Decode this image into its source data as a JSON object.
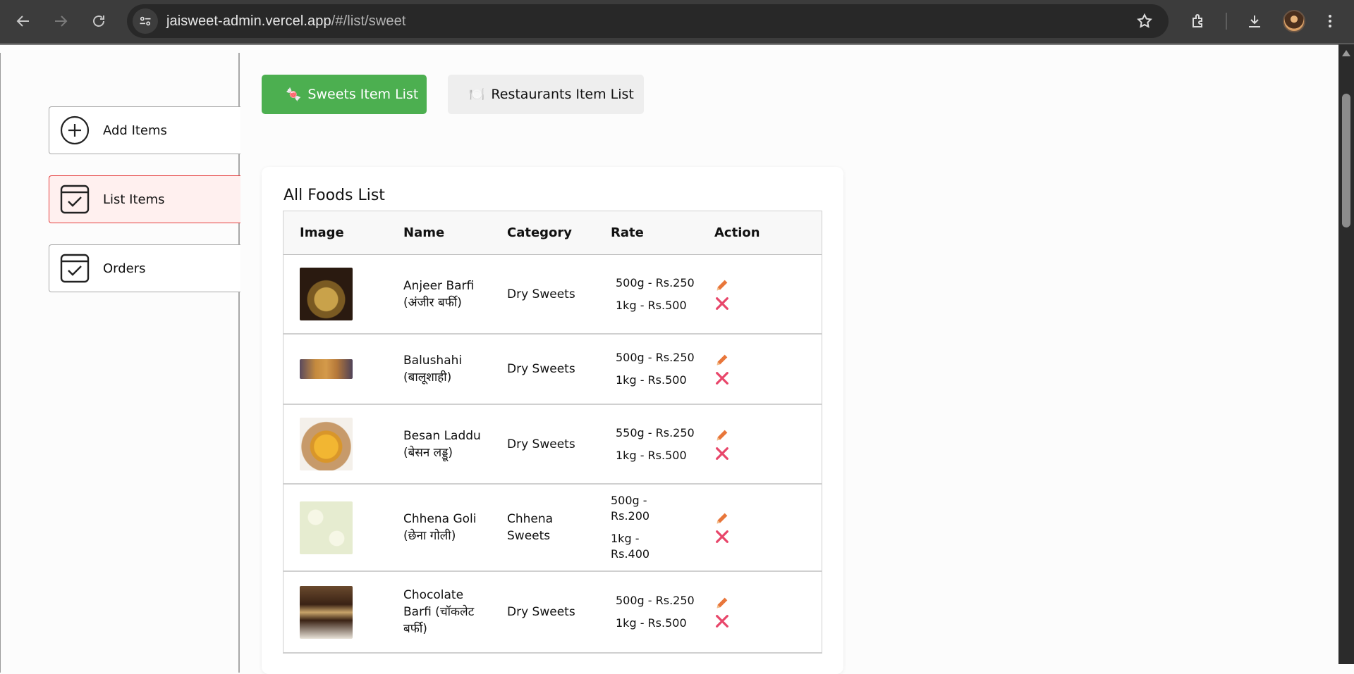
{
  "browser": {
    "url_host": "jaisweet-admin.vercel.app",
    "url_path": "/#/list/sweet"
  },
  "sidebar": {
    "items": [
      {
        "label": "Add Items",
        "icon": "plus-circle-icon"
      },
      {
        "label": "List Items",
        "icon": "list-check-icon",
        "active": true
      },
      {
        "label": "Orders",
        "icon": "list-check-icon"
      }
    ]
  },
  "tabs": {
    "sweets": {
      "emoji": "🍬",
      "label": "Sweets Item List"
    },
    "restaurants": {
      "emoji": "🍽️",
      "label": "Restaurants Item List"
    }
  },
  "list": {
    "title": "All Foods List",
    "headers": {
      "image": "Image",
      "name": "Name",
      "category": "Category",
      "rate": "Rate",
      "action": "Action"
    },
    "rows": [
      {
        "name": "Anjeer Barfi (अंजीर बर्फी)",
        "category": "Dry Sweets",
        "rate1": "500g - Rs.250",
        "rate2": "1kg - Rs.500"
      },
      {
        "name": "Balushahi (बालूशाही)",
        "category": "Dry Sweets",
        "rate1": "500g - Rs.250",
        "rate2": "1kg - Rs.500"
      },
      {
        "name": "Besan Laddu (बेसन लड्डू)",
        "category": "Dry Sweets",
        "rate1": "550g - Rs.250",
        "rate2": "1kg - Rs.500"
      },
      {
        "name": "Chhena Goli (छेना गोली)",
        "category": "Chhena Sweets",
        "rate1": "500g - Rs.200",
        "rate2": "1kg - Rs.400"
      },
      {
        "name": "Chocolate Barfi (चॉकलेट बर्फी)",
        "category": "Dry Sweets",
        "rate1": "500g - Rs.250",
        "rate2": "1kg - Rs.500"
      }
    ]
  },
  "colors": {
    "accent_green": "#4caf50",
    "active_border": "#e53e3e",
    "edit_icon": "#e8763a",
    "delete_icon": "#e8466a"
  }
}
